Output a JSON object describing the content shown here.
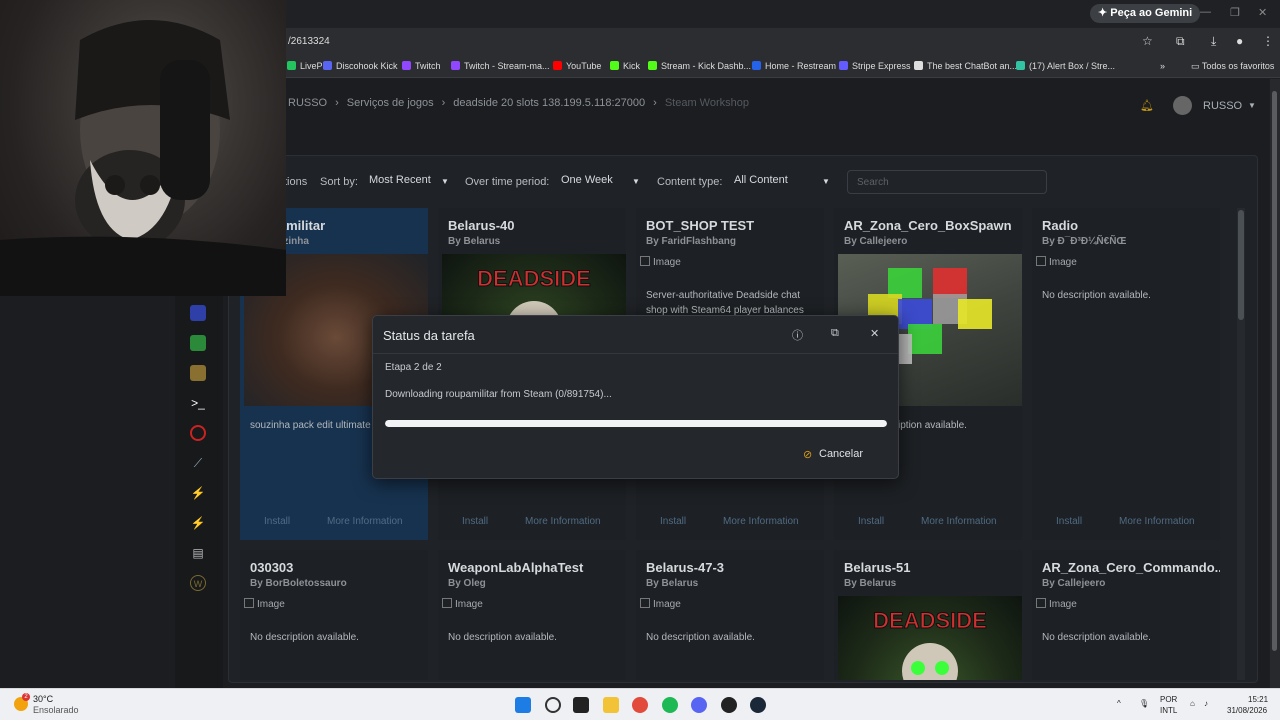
{
  "browser": {
    "gemini_button": "Peça ao Gemini",
    "url_fragment": "/2613324",
    "bookmarks": [
      {
        "label": "LivePix",
        "color": "#22c55e"
      },
      {
        "label": "Discohook Kick",
        "color": "#5865f2"
      },
      {
        "label": "Twitch",
        "color": "#9146ff"
      },
      {
        "label": "Twitch - Stream-ma...",
        "color": "#9146ff"
      },
      {
        "label": "YouTube",
        "color": "#ff0000"
      },
      {
        "label": "Kick",
        "color": "#53fc18"
      },
      {
        "label": "Stream - Kick Dashb...",
        "color": "#53fc18"
      },
      {
        "label": "Home - Restream",
        "color": "#2563eb"
      },
      {
        "label": "Stripe Express",
        "color": "#635bff"
      },
      {
        "label": "The best ChatBot an...",
        "color": "#dddddd"
      },
      {
        "label": "(17) Alert Box / Stre...",
        "color": "#31c3a2"
      }
    ],
    "all_favorites": "Todos os favoritos"
  },
  "header": {
    "breadcrumb": [
      "RUSSO",
      "Serviços de jogos",
      "deadside 20 slots 138.199.5.118:27000",
      "Steam Workshop"
    ],
    "username": "RUSSO"
  },
  "filters": {
    "options_label": "tions",
    "sort_label": "Sort by:",
    "sort_value": "Most Recent",
    "period_label": "Over time period:",
    "period_value": "One Week",
    "content_label": "Content type:",
    "content_value": "All Content",
    "search_placeholder": "Search"
  },
  "cards_row1": [
    {
      "title": "roupamilitar",
      "author": "By souzinha",
      "desc": "souzinha pack edit ultimate bahia pack",
      "image": "photo"
    },
    {
      "title": "Belarus-40",
      "author": "By Belarus",
      "desc": "",
      "image": "deadside"
    },
    {
      "title": "BOT_SHOP TEST",
      "author": "By FaridFlashbang",
      "desc": "Server-authoritative Deadside chat shop with Steam64 player balances",
      "image": "broken"
    },
    {
      "title": "AR_Zona_Cero_BoxSpawn",
      "author": "By Callejeero",
      "desc": "No description available.",
      "image": "boxes"
    },
    {
      "title": "Radio",
      "author": "By Ð¯Ð³Ð¼Ñ€ÑŒ",
      "desc": "No description available.",
      "image": "broken"
    }
  ],
  "cards_row2": [
    {
      "title": "030303",
      "author": "By BorBoletossauro",
      "desc": "No description available.",
      "image": "broken"
    },
    {
      "title": "WeaponLabAlphaTest",
      "author": "By Oleg",
      "desc": "No description available.",
      "image": "broken"
    },
    {
      "title": "Belarus-47-3",
      "author": "By Belarus",
      "desc": "No description available.",
      "image": "broken"
    },
    {
      "title": "Belarus-51",
      "author": "By Belarus",
      "desc": "",
      "image": "deadside"
    },
    {
      "title": "AR_Zona_Cero_Commando...",
      "author": "By Callejeero",
      "desc": "No description available.",
      "image": "broken"
    }
  ],
  "card_actions": {
    "install": "Install",
    "more_info": "More Information"
  },
  "broken_image_alt": "Image",
  "deadside_logo": "DEADSIDE",
  "modal": {
    "title": "Status da tarefa",
    "step": "Etapa 2 de 2",
    "message": "Downloading roupamilitar from Steam (0/891754)...",
    "progress_fraction": 1.0,
    "cancel_label": "Cancelar"
  },
  "taskbar": {
    "temp": "30°C",
    "weather": "Ensolarado",
    "weather_badge": "2",
    "lang_top": "POR",
    "lang_bottom": "INTL",
    "time": "15:21",
    "date": "31/08/2026"
  }
}
